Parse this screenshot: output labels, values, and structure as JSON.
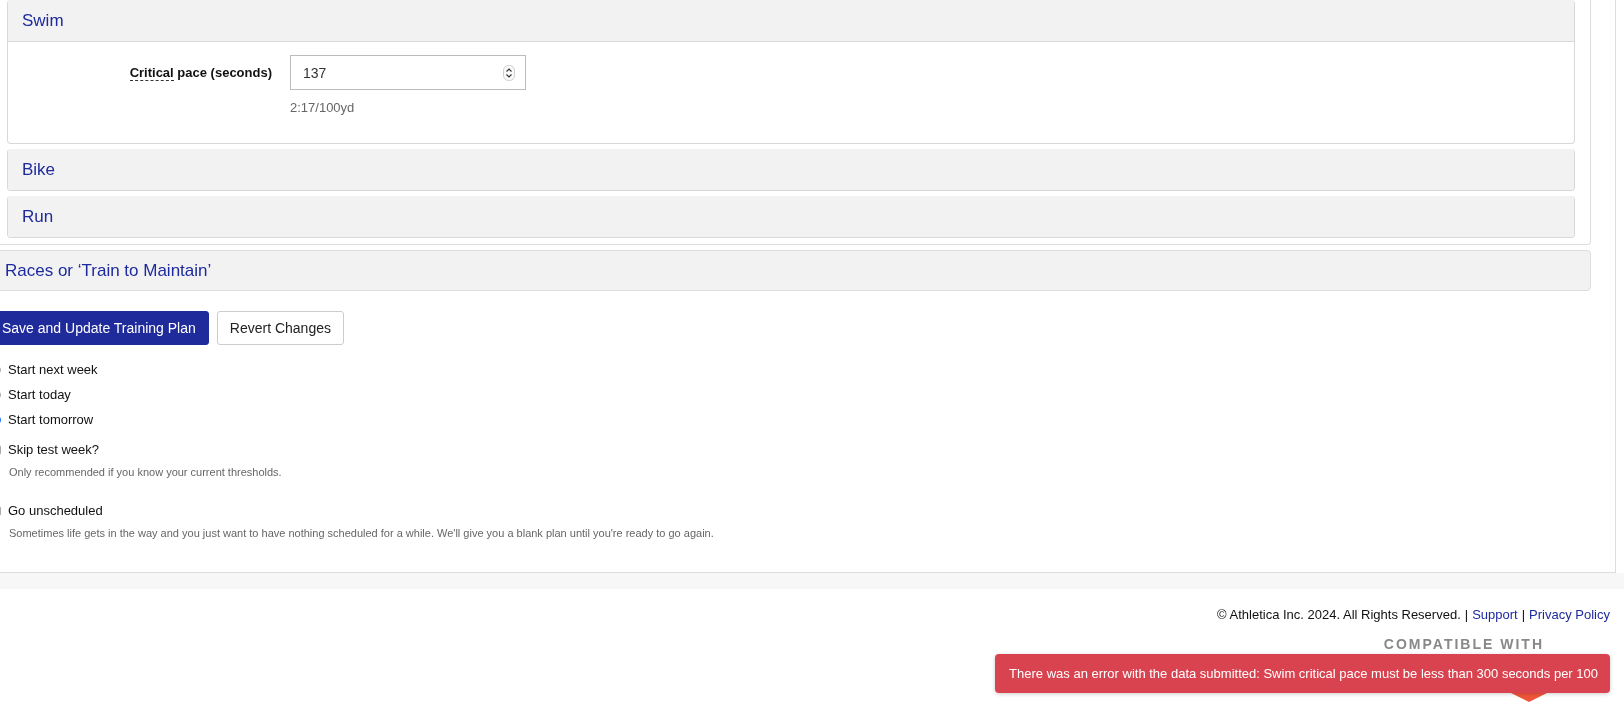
{
  "sports": [
    {
      "name": "Swim",
      "expanded": true,
      "field": {
        "label_abbr": "Critical",
        "label_rest": "pace (seconds)",
        "value": "137",
        "hint": "2:17/100yd"
      }
    },
    {
      "name": "Bike",
      "expanded": false
    },
    {
      "name": "Run",
      "expanded": false
    }
  ],
  "races": {
    "title": "Races or ‘Train to Maintain’",
    "expanded": false
  },
  "buttons": [
    {
      "label": "Save and Update Training Plan",
      "kind": "primary"
    },
    {
      "label": "Revert Changes",
      "kind": "secondary"
    }
  ],
  "start_options": [
    {
      "label": "Start next week",
      "selected": false
    },
    {
      "label": "Start today",
      "selected": false
    },
    {
      "label": "Start tomorrow",
      "selected": true
    }
  ],
  "options": [
    {
      "label": "Skip test week?",
      "checked": false,
      "description": "Only recommended if you know your current thresholds."
    },
    {
      "label": "Go unscheduled",
      "checked": false,
      "description": "Sometimes life gets in the way and you just want to have nothing scheduled for a while. We'll give you a blank plan until you're ready to go again."
    }
  ],
  "footer": [
    {
      "kind": "text",
      "text": "© Athletica Inc. 2024. All Rights Reserved."
    },
    {
      "kind": "sep",
      "text": "|"
    },
    {
      "kind": "link",
      "text": "Support"
    },
    {
      "kind": "sep",
      "text": "|"
    },
    {
      "kind": "link",
      "text": "Privacy Policy"
    }
  ],
  "compatible": "COMPATIBLE WITH",
  "toast": "There was an error with the data submitted: Swim critical pace must be less than 300 seconds per 100"
}
